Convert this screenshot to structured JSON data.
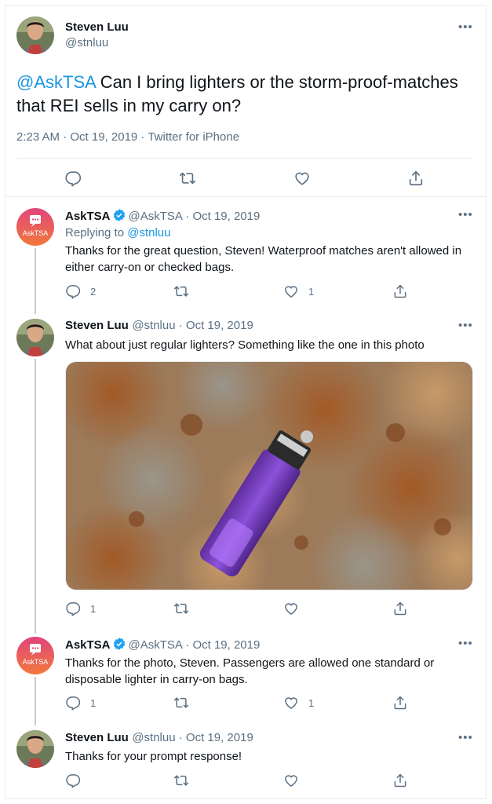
{
  "main_tweet": {
    "name": "Steven Luu",
    "handle": "@stnluu",
    "mention": "@AskTSA",
    "text": " Can I bring lighters or the storm-proof-matches that REI sells in my carry on?",
    "timestamp": "2:23 AM · Oct 19, 2019 · Twitter for iPhone"
  },
  "replies": [
    {
      "name": "AskTSA",
      "handle": "@AskTSA",
      "date": " · Oct 19, 2019",
      "avatar_label": "AskTSA",
      "replying_prefix": "Replying to ",
      "replying_to": "@stnluu",
      "text": "Thanks for the great question, Steven! Waterproof matches aren't allowed in either carry-on or checked bags.",
      "reply_count": "2",
      "like_count": "1"
    },
    {
      "name": "Steven Luu",
      "handle": "@stnluu",
      "date": " · Oct 19, 2019",
      "text": "What about just regular lighters? Something like the one in this photo",
      "reply_count": "1"
    },
    {
      "name": "AskTSA",
      "handle": "@AskTSA",
      "date": " · Oct 19, 2019",
      "avatar_label": "AskTSA",
      "text": "Thanks for the photo, Steven. Passengers are allowed one standard or disposable lighter in carry-on bags.",
      "reply_count": "1",
      "like_count": "1"
    },
    {
      "name": "Steven Luu",
      "handle": "@stnluu",
      "date": " · Oct 19, 2019",
      "text": "Thanks for your prompt response!"
    }
  ],
  "more_label": "•••",
  "colors": {
    "link": "#1b95e0",
    "secondary": "#5b7083",
    "border": "#e6ecf0",
    "tsa_top": "#e0457b",
    "tsa_bottom": "#f2783c"
  },
  "icons": [
    "reply-icon",
    "retweet-icon",
    "like-icon",
    "share-icon",
    "more-icon",
    "verified-icon"
  ]
}
